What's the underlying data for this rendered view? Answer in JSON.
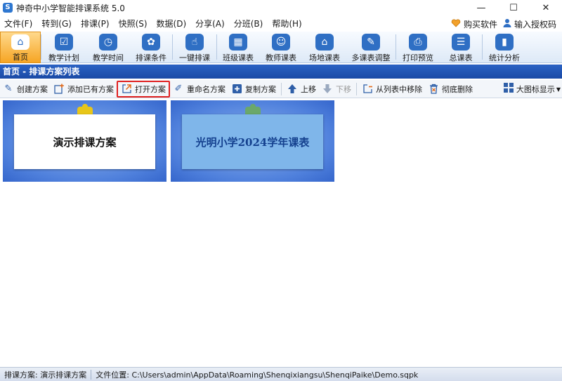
{
  "window": {
    "title": "神奇中小学智能排课系统 5.0",
    "icon_letter": "S",
    "controls": [
      "—",
      "☐",
      "✕"
    ]
  },
  "menu": {
    "items": [
      "文件(F)",
      "转到(G)",
      "排课(P)",
      "快照(S)",
      "数据(D)",
      "分享(A)",
      "分班(B)",
      "帮助(H)"
    ],
    "buy": "购买软件",
    "license": "输入授权码"
  },
  "ribbon": {
    "buttons": [
      {
        "label": "首页",
        "icon": "home-icon",
        "glyph": "⌂"
      },
      {
        "label": "教学计划",
        "icon": "plan-icon",
        "glyph": "☑"
      },
      {
        "label": "教学时间",
        "icon": "clock-icon",
        "glyph": "◷"
      },
      {
        "label": "排课条件",
        "icon": "conditions-icon",
        "glyph": "✿"
      },
      {
        "label": "一键排课",
        "icon": "one-click-icon",
        "glyph": "☝"
      },
      {
        "label": "班级课表",
        "icon": "class-schedule-icon",
        "glyph": "▦"
      },
      {
        "label": "教师课表",
        "icon": "teacher-schedule-icon",
        "glyph": "☺"
      },
      {
        "label": "场地课表",
        "icon": "venue-schedule-icon",
        "glyph": "⌂"
      },
      {
        "label": "多课表调整",
        "icon": "multi-adjust-icon",
        "glyph": "✎"
      },
      {
        "label": "打印预览",
        "icon": "print-icon",
        "glyph": "⎙"
      },
      {
        "label": "总课表",
        "icon": "master-schedule-icon",
        "glyph": "☰"
      },
      {
        "label": "统计分析",
        "icon": "stats-icon",
        "glyph": "▮"
      }
    ]
  },
  "path": "首页 - 排课方案列表",
  "toolbar": {
    "create": "创建方案",
    "add_existing": "添加已有方案",
    "open": "打开方案",
    "rename": "重命名方案",
    "copy": "复制方案",
    "up": "上移",
    "down": "下移",
    "remove": "从列表中移除",
    "delete": "彻底删除",
    "view_mode": "大图标显示"
  },
  "cards": [
    {
      "title": "演示排课方案",
      "paper_color": "#ffffff",
      "clip_color": "#e8c619",
      "text_color": "#111111"
    },
    {
      "title": "光明小学2024学年课表",
      "paper_color": "#7fb6ea",
      "clip_color": "#6ba86b",
      "text_color": "#14408e"
    }
  ],
  "status": {
    "scheme_label": "排课方案:",
    "scheme_value": "演示排课方案",
    "file_label": "文件位置:",
    "file_value": "C:\\Users\\admin\\AppData\\Roaming\\Shenqixiangsu\\ShenqiPaike\\Demo.sqpk"
  },
  "colors": {
    "accent": "#2f6fc4",
    "path_bar": "#1f55b5",
    "highlight": "#e02020",
    "active_ribbon": "#f6a524"
  }
}
